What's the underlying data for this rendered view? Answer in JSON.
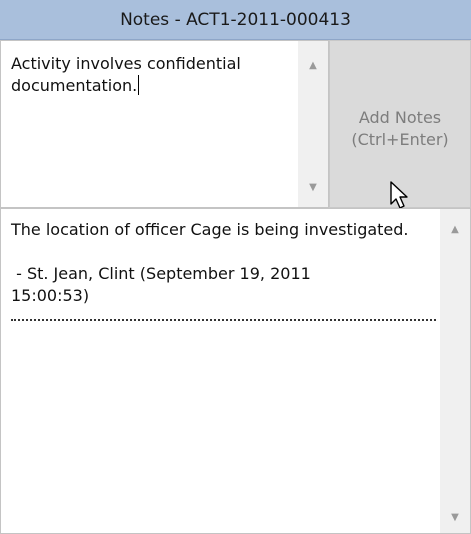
{
  "window": {
    "title": "Notes - ACT1-2011-000413"
  },
  "input": {
    "value": "Activity involves confidential documentation."
  },
  "add_button": {
    "line1": "Add Notes",
    "line2": "(Ctrl+Enter)"
  },
  "history": {
    "note_text": "The location of officer Cage is being investigated.",
    "author_line1": " - St. Jean, Clint (September 19, 2011",
    "author_line2": "15:00:53)"
  },
  "icons": {
    "scroll_up": "scroll-up-arrow-icon",
    "scroll_down": "scroll-down-arrow-icon",
    "cursor": "mouse-pointer-icon"
  },
  "colors": {
    "titlebar": "#a9bfdc",
    "button_bg": "#dadada",
    "button_text": "#7d7d7d"
  }
}
